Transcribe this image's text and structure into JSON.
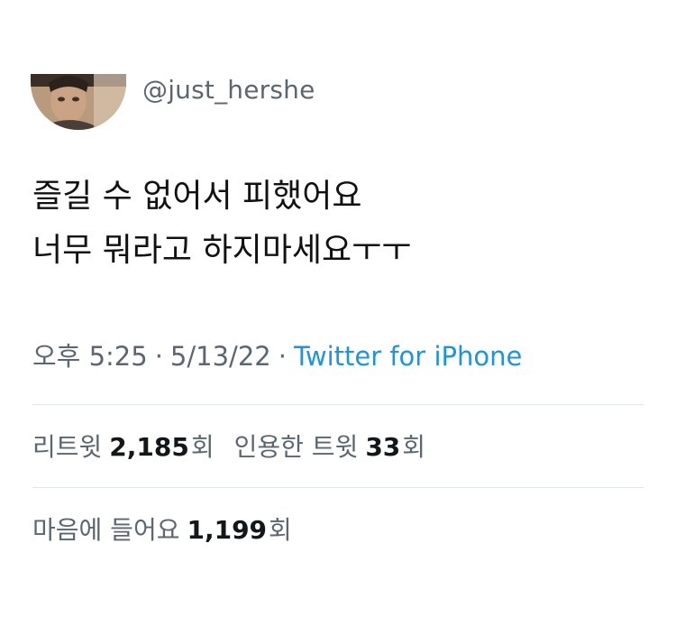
{
  "user": {
    "handle": "@just_hershe"
  },
  "tweet": {
    "line1": "즐길 수 없어서 피했어요",
    "line2": "너무 뭐라고 하지마세요ㅜㅜ",
    "time": "오후 5:25",
    "separator1": "·",
    "date": "5/13/22",
    "separator2": "·",
    "source": "Twitter for iPhone"
  },
  "stats": {
    "retweets_label": "리트윗",
    "retweets_count": "2,185",
    "retweets_unit": "회",
    "quotes_label": "인용한 트윗",
    "quotes_count": "33",
    "quotes_unit": "회",
    "likes_label": "마음에 들어요",
    "likes_count": "1,199",
    "likes_unit": "회"
  },
  "colors": {
    "source_link": "#1b95e0",
    "muted_text": "#5b6670",
    "divider": "#e3e6e8"
  }
}
